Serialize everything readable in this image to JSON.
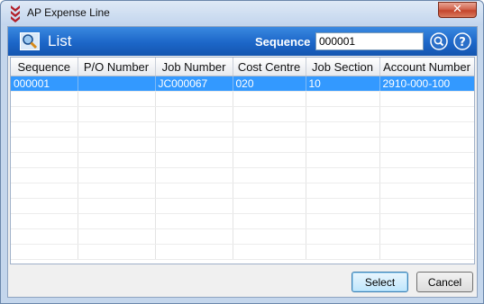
{
  "window": {
    "title": "AP Expense Line",
    "close_glyph": "✕"
  },
  "header": {
    "title": "List",
    "sequence_label": "Sequence",
    "sequence_value": "000001"
  },
  "grid": {
    "columns": [
      "Sequence",
      "P/O Number",
      "Job Number",
      "Cost Centre",
      "Job Section",
      "Account Number"
    ],
    "rows": [
      [
        "000001",
        "",
        "JC000067",
        "020",
        "10",
        "2910-000-100"
      ]
    ]
  },
  "buttons": {
    "select": "Select",
    "cancel": "Cancel"
  },
  "colors": {
    "header": "#1c66c8",
    "selection": "#3399ff",
    "window_frame": "#c4d6ec"
  }
}
